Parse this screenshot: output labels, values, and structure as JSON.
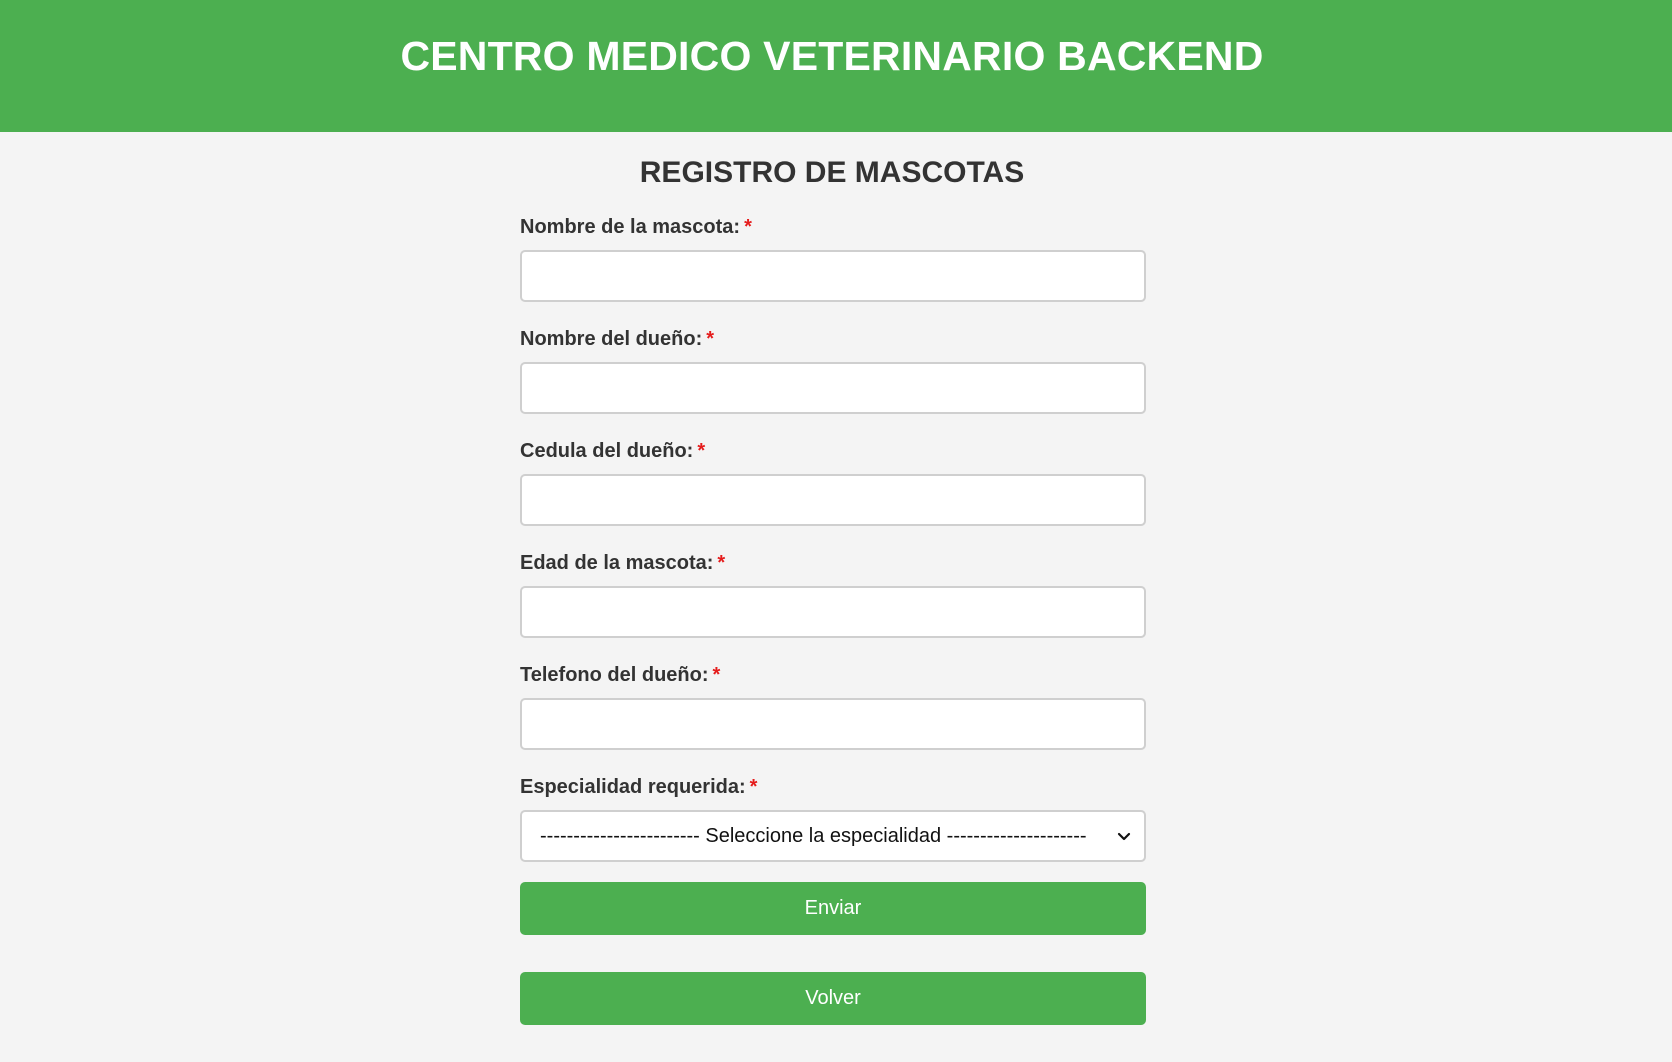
{
  "header": {
    "title": "CENTRO MEDICO VETERINARIO BACKEND"
  },
  "form": {
    "title": "REGISTRO DE MASCOTAS",
    "required_marker": "*",
    "fields": [
      {
        "label": "Nombre de la mascota:",
        "value": ""
      },
      {
        "label": "Nombre del dueño:",
        "value": ""
      },
      {
        "label": "Cedula del dueño:",
        "value": ""
      },
      {
        "label": "Edad de la mascota:",
        "value": ""
      },
      {
        "label": "Telefono del dueño:",
        "value": ""
      }
    ],
    "specialty": {
      "label": "Especialidad requerida:",
      "selected": "------------------------ Seleccione la especialidad ---------------------"
    },
    "submit_label": "Enviar",
    "back_label": "Volver"
  },
  "colors": {
    "brand_green": "#4caf50",
    "background": "#f4f4f4",
    "required_red": "#e51c1c"
  }
}
